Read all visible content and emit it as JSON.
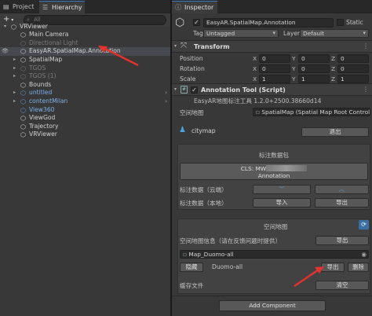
{
  "left_panel": {
    "tabs": [
      "Project",
      "Hierarchy"
    ],
    "search_placeholder": "All",
    "add_label": "+",
    "tree": [
      {
        "label": "VRViewer",
        "level": 0,
        "kind": "root",
        "expanded": true
      },
      {
        "label": "Main Camera",
        "level": 1,
        "kind": "normal"
      },
      {
        "label": "Directional Light",
        "level": 1,
        "kind": "dim"
      },
      {
        "label": "EasyAR.SpatialMap.Annotation",
        "level": 1,
        "kind": "selected"
      },
      {
        "label": "SpatialMap",
        "level": 1,
        "kind": "normal",
        "collapsed": true
      },
      {
        "label": "TGOS",
        "level": 1,
        "kind": "dim",
        "collapsed": true
      },
      {
        "label": "TGOS (1)",
        "level": 1,
        "kind": "dim",
        "collapsed": true
      },
      {
        "label": "Bounds",
        "level": 1,
        "kind": "normal"
      },
      {
        "label": "untitled",
        "level": 1,
        "kind": "prefab",
        "collapsed": true
      },
      {
        "label": "contentMilan",
        "level": 1,
        "kind": "prefab",
        "collapsed": true
      },
      {
        "label": "View360",
        "level": 1,
        "kind": "prefab"
      },
      {
        "label": "ViewGod",
        "level": 1,
        "kind": "normal"
      },
      {
        "label": "Trajectory",
        "level": 1,
        "kind": "normal"
      },
      {
        "label": "VRViewer",
        "level": 1,
        "kind": "normal"
      }
    ]
  },
  "inspector": {
    "tab": "Inspector",
    "object_name": "EasyAR.SpatialMap.Annotation",
    "static_label": "Static",
    "tag_label": "Tag",
    "tag_value": "Untagged",
    "layer_label": "Layer",
    "layer_value": "Default",
    "transform": {
      "title": "Transform",
      "rows": [
        {
          "label": "Position",
          "x": "0",
          "y": "0",
          "z": "0"
        },
        {
          "label": "Rotation",
          "x": "0",
          "y": "0",
          "z": "0"
        },
        {
          "label": "Scale",
          "x": "1",
          "y": "1",
          "z": "1"
        }
      ],
      "axis": [
        "X",
        "Y",
        "Z"
      ]
    },
    "script": {
      "title": "Annotation Tool (Script)",
      "version": "EasyAR地图标注工具 1.2.0+2500.38660d14",
      "spatial_map_label": "空间地图",
      "spatial_map_value": "SpatialMap (Spatial Map Root Controlle",
      "user": "citymap",
      "logout": "退出",
      "annotation_pkg": "标注数据包",
      "cls_line1": "CLS: MW",
      "cls_line2": "Annotation",
      "cloud_label": "标注数据（云端）",
      "local_label": "标注数据（本地）",
      "import_label": "导入",
      "export_label": "导出",
      "spatial_map_section": "空间地图",
      "map_info_label": "空间地图信息（请在反馈问题时提供）",
      "map_info_export": "导出",
      "map_field": "Map_Duomo-all",
      "hide_label": "隐藏",
      "map_name": "Duomo-all",
      "map_export": "导出",
      "map_delete": "删除",
      "cache_label": "缓存文件",
      "cache_clear": "清空"
    },
    "add_component": "Add Component"
  },
  "colors": {
    "accent": "#3a79bb",
    "selected_row": "#46494f",
    "prefab": "#7db1e8",
    "annotation_red": "#e5322d"
  }
}
